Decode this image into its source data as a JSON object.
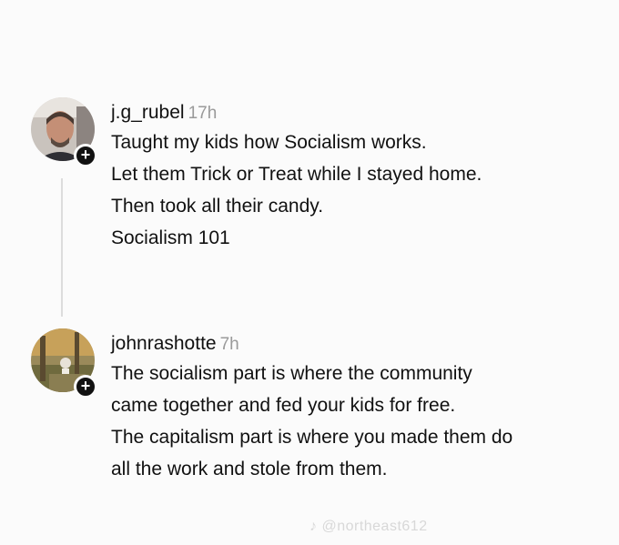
{
  "thread": {
    "posts": [
      {
        "username": "j.g_rubel",
        "timestamp": "17h",
        "avatar_icon": "user-avatar-icon",
        "follow_icon": "plus-icon",
        "follow_symbol": "+",
        "lines": [
          "Taught my kids how Socialism works.",
          "Let them Trick or Treat while I stayed home.",
          "Then took all their candy.",
          "Socialism 101"
        ]
      },
      {
        "username": "johnrashotte",
        "timestamp": "7h",
        "avatar_icon": "user-avatar-icon",
        "follow_icon": "plus-icon",
        "follow_symbol": "+",
        "lines": [
          "The socialism part is where the community",
          "came together and fed your kids for free.",
          "The capitalism part is where you made them do",
          "all the work and stole from them."
        ]
      }
    ]
  },
  "watermark": {
    "text": "♪ @northeast612",
    "icon": "tiktok-icon"
  },
  "colors": {
    "background": "#fbfbfb",
    "text": "#111111",
    "timestamp": "#9a9a9a",
    "thread_line": "#dcdcdc",
    "badge": "#111111"
  }
}
